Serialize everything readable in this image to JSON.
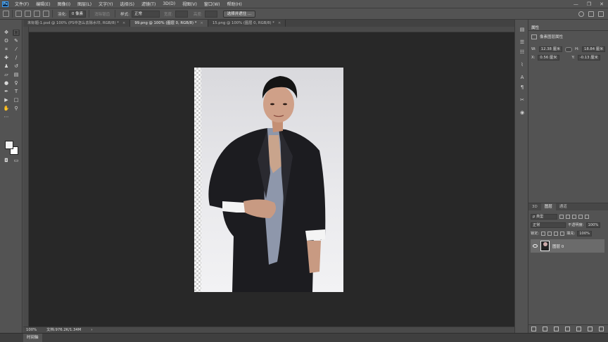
{
  "app": {
    "logo": "Ps"
  },
  "menubar": {
    "items": [
      "文件(F)",
      "编辑(E)",
      "图像(I)",
      "图层(L)",
      "文字(Y)",
      "选择(S)",
      "滤镜(T)",
      "3D(D)",
      "视图(V)",
      "窗口(W)",
      "帮助(H)"
    ],
    "window_controls": [
      "—",
      "❐",
      "✕"
    ]
  },
  "options_bar": {
    "feather_label": "羽化:",
    "feather_value": "0 像素",
    "antialias_label": "消除锯齿",
    "style_label": "样式:",
    "style_value": "正常",
    "width_label": "宽度:",
    "height_label": "高度:",
    "select_mask_button": "选择并遮住 ..."
  },
  "tabs": [
    {
      "label": "未标题-1.psd @ 100% (PS中怎么去除水印, RGB/8) *",
      "active": false
    },
    {
      "label": "99.png @ 100% (图层 0, RGB/8) *",
      "active": true
    },
    {
      "label": "15.png @ 100% (图层 0, RGB/8) *",
      "active": false
    }
  ],
  "tab_close": "×",
  "status": {
    "zoom": "100%",
    "doc_size": "文档:976.2K/1.34M",
    "arrow": "›"
  },
  "timeline": {
    "label": "时间轴"
  },
  "properties": {
    "title": "属性",
    "subtitle": "像素图层属性",
    "w_label": "W:",
    "w_value": "12.38 厘米",
    "h_label": "H:",
    "h_value": "18.84 厘米",
    "x_label": "X:",
    "x_value": "0.56 厘米",
    "y_label": "Y:",
    "y_value": "-0.13 厘米"
  },
  "layers": {
    "tabs": [
      "3D",
      "图层",
      "通道"
    ],
    "active_tab": "图层",
    "filter_label": "ρ 类型",
    "blend_mode": "正常",
    "opacity_label": "不透明度:",
    "opacity_value": "100%",
    "lock_label": "锁定:",
    "fill_label": "填充:",
    "fill_value": "100%",
    "items": [
      {
        "name": "图层 0",
        "visible": true
      }
    ]
  },
  "colors": {
    "accent": "#3aa0ff",
    "ui_bg": "#535353",
    "canvas_bg": "#282828",
    "selected_layer": "#6b6b6b"
  }
}
